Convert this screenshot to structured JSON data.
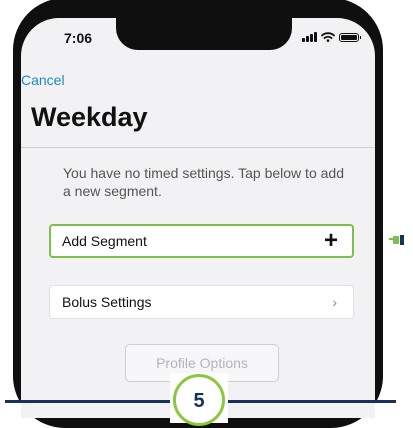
{
  "status_bar": {
    "time": "7:06"
  },
  "nav": {
    "cancel_label": "Cancel"
  },
  "page": {
    "title": "Weekday"
  },
  "info_text": "You have no timed settings. Tap below to add a new segment.",
  "rows": [
    {
      "label": "Add Segment",
      "icon": "plus-icon"
    },
    {
      "label": "Bolus Settings",
      "icon": "chevron-right-icon"
    }
  ],
  "profile_button": {
    "label": "Profile Options"
  },
  "step_badge": {
    "number": "5"
  },
  "colors": {
    "accent_link": "#1e88c9",
    "highlight": "#7cc04a",
    "navy": "#16325c"
  }
}
